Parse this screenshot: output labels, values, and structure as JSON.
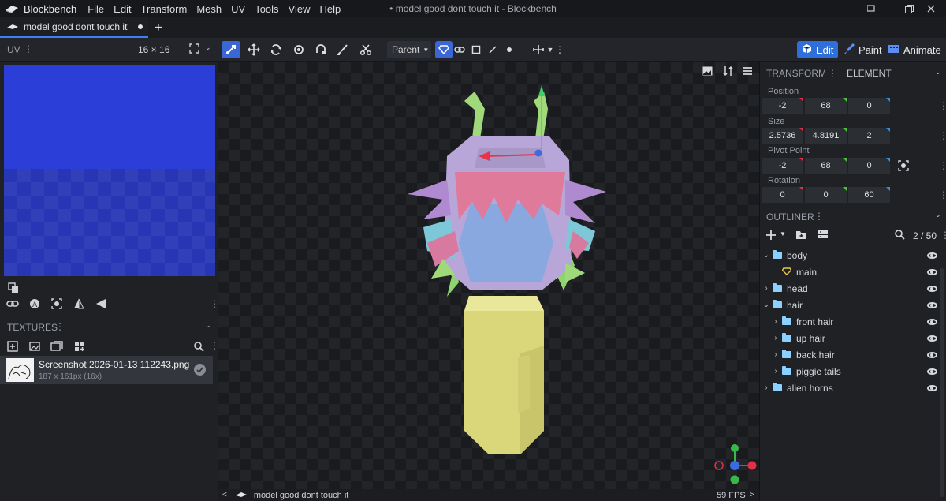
{
  "titlebar": {
    "app_name": "Blockbench",
    "menu": [
      "File",
      "Edit",
      "Transform",
      "Mesh",
      "UV",
      "Tools",
      "View",
      "Help"
    ],
    "window_title": "• model good dont touch it - Blockbench"
  },
  "tabs": [
    {
      "label": "model good dont touch it"
    }
  ],
  "toolbar": {
    "parent_select": "Parent",
    "modes": {
      "edit": "Edit",
      "paint": "Paint",
      "animate": "Animate"
    }
  },
  "uv_panel": {
    "title": "UV",
    "size_label": "16 × 16"
  },
  "textures_panel": {
    "title": "TEXTURES",
    "items": [
      {
        "name": "Screenshot 2026-01-13 112243.png",
        "meta": "187 x 161px (16x)"
      }
    ]
  },
  "right_panel": {
    "tabs": {
      "transform": "TRANSFORM",
      "element": "ELEMENT"
    },
    "position": {
      "label": "Position",
      "values": [
        "-2",
        "68",
        "0"
      ]
    },
    "size": {
      "label": "Size",
      "values": [
        "2.5736",
        "4.8191",
        "2"
      ]
    },
    "pivot": {
      "label": "Pivot Point",
      "values": [
        "-2",
        "68",
        "0"
      ]
    },
    "rotation": {
      "label": "Rotation",
      "values": [
        "0",
        "0",
        "60"
      ]
    },
    "axis_colors": [
      "#e0304a",
      "#4cc03a",
      "#2f8fe6"
    ]
  },
  "outliner": {
    "title": "OUTLINER",
    "count": "2 / 50",
    "items": [
      {
        "label": "body"
      },
      {
        "label": "main"
      },
      {
        "label": "head"
      },
      {
        "label": "hair"
      },
      {
        "label": "front hair"
      },
      {
        "label": "up hair"
      },
      {
        "label": "back hair"
      },
      {
        "label": "piggie tails"
      },
      {
        "label": "alien horns"
      }
    ]
  },
  "statusbar": {
    "model_name": "model good dont touch it",
    "fps": "59 FPS"
  },
  "colors": {
    "accent": "#3a66d6",
    "uv_fill": "#2c3ed8"
  }
}
